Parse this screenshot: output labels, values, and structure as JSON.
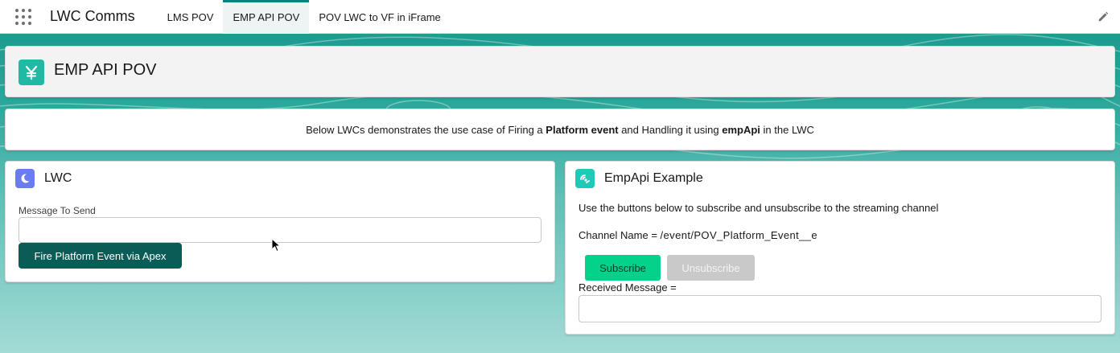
{
  "app": {
    "name": "LWC Comms",
    "tabs": [
      {
        "label": "LMS POV",
        "active": false
      },
      {
        "label": "EMP API POV",
        "active": true
      },
      {
        "label": "POV LWC to VF in iFrame",
        "active": false
      }
    ],
    "edit_icon": "pencil-icon",
    "launcher_icon": "app-launcher-icon"
  },
  "page_header": {
    "title": "EMP API POV",
    "icon": "custom-yen-icon"
  },
  "intro": {
    "text_before": "Below LWCs demonstrates the use case of Firing a ",
    "bold_1": "Platform event",
    "text_middle": " and Handling it using ",
    "bold_2": "empApi",
    "text_after": " in the LWC"
  },
  "lwc_card": {
    "title": "LWC",
    "icon": "moon-icon",
    "message_label": "Message To Send",
    "message_value": "",
    "fire_button": "Fire Platform Event via Apex"
  },
  "emp_card": {
    "title": "EmpApi Example",
    "icon": "streaming-icon",
    "instructions": "Use the buttons below to subscribe and unsubscribe to the streaming channel",
    "channel_label": "Channel Name = ",
    "channel_value": "/event/POV_Platform_Event__e",
    "subscribe_button": "Subscribe",
    "unsubscribe_button": "Unsubscribe",
    "received_label": "Received Message =",
    "received_value": ""
  },
  "colors": {
    "brand_teal": "#0b827c",
    "fire_button": "#0a5c57",
    "subscribe_button": "#04d28a",
    "disabled_button": "#c9c9c9",
    "header_icon": "#1fb9a4",
    "lwc_icon": "#6b7cf0",
    "emp_icon": "#1fc9b7"
  }
}
